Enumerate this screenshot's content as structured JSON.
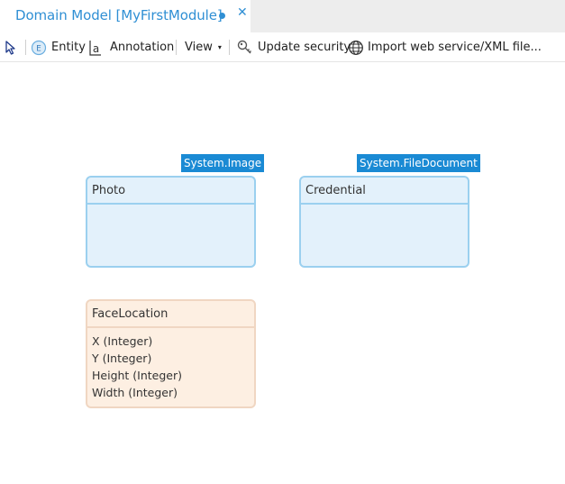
{
  "tab": {
    "title": "Domain Model [MyFirstModule]",
    "close_glyph": "✕",
    "accent_color": "#2f8fd4"
  },
  "toolbar": {
    "select_icon": "pointer-icon",
    "entity_label": "Entity",
    "annotation_label": "Annotation",
    "view_label": "View",
    "view_caret": "▾",
    "update_security_label": "Update security",
    "import_label": "Import web service/XML file..."
  },
  "entities": [
    {
      "name": "Photo",
      "generalization": "System.Image",
      "persistable": true,
      "attributes": []
    },
    {
      "name": "Credential",
      "generalization": "System.FileDocument",
      "persistable": true,
      "attributes": []
    },
    {
      "name": "FaceLocation",
      "persistable": false,
      "attributes": [
        "X (Integer)",
        "Y (Integer)",
        "Height (Integer)",
        "Width (Integer)"
      ]
    }
  ],
  "colors": {
    "persistable_fill": "#e3f1fb",
    "persistable_border": "#9bd0ef",
    "non_persistable_fill": "#fdefe2",
    "non_persistable_border": "#f0d6c2",
    "generalization_tag": "#1a8ad4"
  }
}
